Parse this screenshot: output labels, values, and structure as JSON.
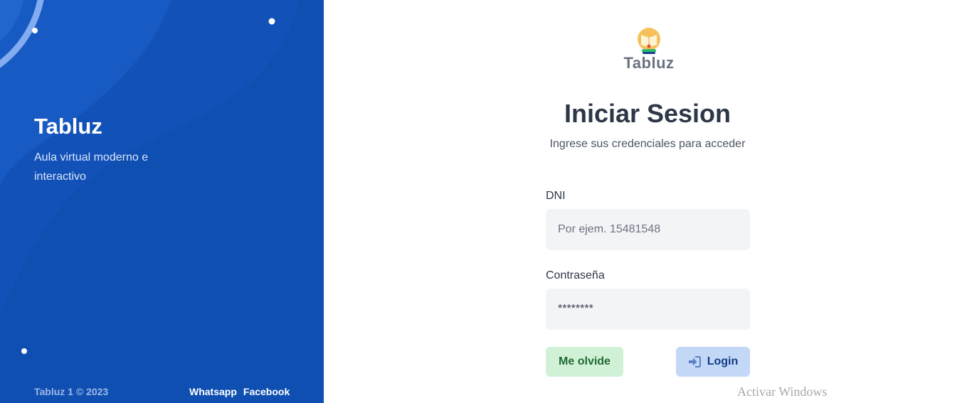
{
  "hero": {
    "title": "Tabluz",
    "subtitle": "Aula virtual moderno e interactivo",
    "copyright": "Tabluz 1 © 2023",
    "links": [
      {
        "label": "Whatsapp"
      },
      {
        "label": "Facebook"
      }
    ],
    "background_color": "#0f4fb1"
  },
  "logo": {
    "text": "Tabluz",
    "icon": "bulb-book-logo-icon"
  },
  "form": {
    "title": "Iniciar Sesion",
    "subtitle": "Ingrese sus credenciales para acceder",
    "dni": {
      "label": "DNI",
      "placeholder": "Por ejem. 15481548",
      "value": ""
    },
    "password": {
      "label": "Contraseña",
      "value": "********"
    },
    "forgot_label": "Me olvide",
    "login_label": "Login",
    "login_icon": "sign-in-icon"
  },
  "os": {
    "watermark": "Activar Windows"
  },
  "colors": {
    "primary": "#0f4fb1",
    "forgot_bg": "#d1f1d6",
    "login_bg": "#c3d8f7",
    "input_bg": "#f3f4f6"
  }
}
